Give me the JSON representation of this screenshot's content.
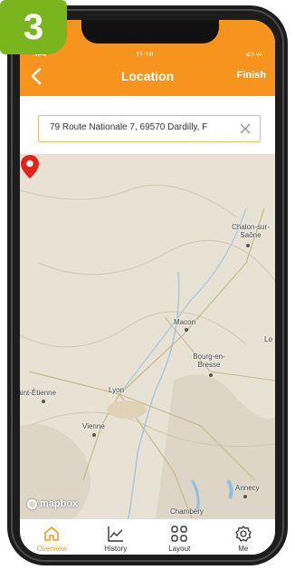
{
  "step_badge": "3",
  "status_bar": {
    "carrier": "SFR",
    "time": "11:18",
    "battery": "43 %"
  },
  "nav": {
    "title": "Location",
    "finish_label": "Finish"
  },
  "search": {
    "value": "79 Route Nationale 7, 69570 Dardilly, F"
  },
  "map": {
    "cities": [
      {
        "name": "Chalon-sur-Saône"
      },
      {
        "name": "Macon"
      },
      {
        "name": "Bourg-en-Bresse"
      },
      {
        "name": "Lyon"
      },
      {
        "name": "Saint-Étienne"
      },
      {
        "name": "Vienne"
      },
      {
        "name": "Annecy"
      },
      {
        "name": "Chambéry"
      },
      {
        "name": "Lo"
      }
    ],
    "attribution": "mapbox"
  },
  "tabs": [
    {
      "label": "Overview",
      "icon": "home-icon",
      "active": true
    },
    {
      "label": "History",
      "icon": "chart-icon",
      "active": false
    },
    {
      "label": "Layout",
      "icon": "grid-icon",
      "active": false
    },
    {
      "label": "Me",
      "icon": "gear-icon",
      "active": false
    }
  ],
  "colors": {
    "accent": "#f7941e",
    "badge": "#7ab51d",
    "pin": "#e2231a"
  }
}
